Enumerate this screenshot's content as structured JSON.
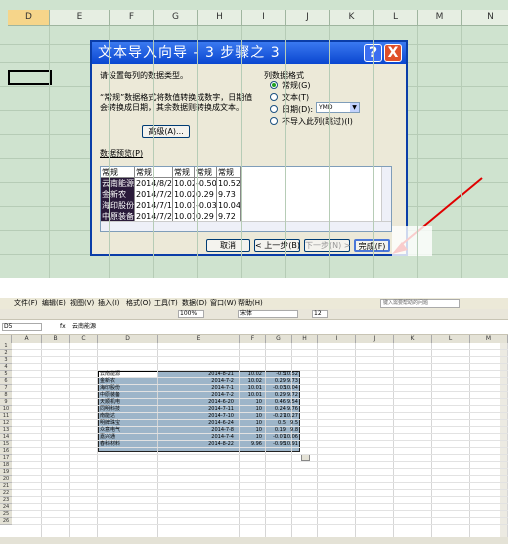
{
  "top_sheet": {
    "columns": [
      "D",
      "E",
      "F",
      "G",
      "H",
      "I",
      "J",
      "K",
      "L",
      "M",
      "N"
    ]
  },
  "dialog": {
    "title": "文本导入向导 - 3 步骤之 3",
    "help_glyph": "?",
    "close_glyph": "X",
    "instruction": "请设置每列的数据类型。",
    "note_line1": "“常规”数据格式将数值转换成数字，日期值",
    "note_line2": "会转换成日期，其余数据则转换成文本。",
    "advanced_button": "高级(A)...",
    "column_format_label": "列数据格式",
    "formats": [
      {
        "label": "常规(G)",
        "selected": true
      },
      {
        "label": "文本(T)",
        "selected": false
      },
      {
        "label": "日期(D):",
        "selected": false
      },
      {
        "label": "不导入此列(跳过)(I)",
        "selected": false
      }
    ],
    "date_format_value": "YMD",
    "preview_label": "数据预览(P)",
    "preview_headers": [
      "常规",
      "常规",
      "常规",
      "常规",
      "常规"
    ],
    "preview_rows": [
      [
        "云南能源",
        "2014/8/21",
        "10.02",
        "-0.50",
        "10.52"
      ],
      [
        "金新农",
        "2014/7/2",
        "10.02",
        "0.29",
        "9.73"
      ],
      [
        "海印股份",
        "2014/7/1",
        "10.01",
        "-0.03",
        "10.04"
      ],
      [
        "中原装备",
        "2014/7/2",
        "10.01",
        "0.29",
        "9.72"
      ]
    ],
    "cancel_button": "取消",
    "back_button": "< 上一步(B)",
    "next_button": "下一步(N) >",
    "finish_button": "完成(F)"
  },
  "bottom_sheet": {
    "menu": [
      "文件(F)",
      "编辑(E)",
      "视图(V)",
      "插入(I)",
      "格式(O)",
      "工具(T)",
      "数据(D)",
      "窗口(W)",
      "帮助(H)"
    ],
    "help_search_placeholder": "键入需要帮助的问题",
    "zoom": "100%",
    "font_name": "宋体",
    "font_size": "12",
    "name_box": "D5",
    "formula_value": "云南能源",
    "columns": [
      "A",
      "B",
      "C",
      "D",
      "E",
      "F",
      "G",
      "H",
      "I",
      "J",
      "K",
      "L",
      "M"
    ],
    "rows": [
      "1",
      "2",
      "3",
      "4",
      "5",
      "6",
      "7",
      "8",
      "9",
      "10",
      "11",
      "12",
      "13",
      "14",
      "15",
      "16",
      "17",
      "18",
      "19",
      "20",
      "21",
      "22",
      "23",
      "24",
      "25",
      "26"
    ],
    "data": [
      [
        "云南能源",
        "2014-8-21",
        "10.02",
        "-0.5",
        "10.52"
      ],
      [
        "金新农",
        "2014-7-2",
        "10.02",
        "0.29",
        "9.73"
      ],
      [
        "海印股份",
        "2014-7-1",
        "10.01",
        "-0.03",
        "10.04"
      ],
      [
        "中原装备",
        "2014-7-2",
        "10.01",
        "0.29",
        "9.72"
      ],
      [
        "天顺机电",
        "2014-6-20",
        "10",
        "0.46",
        "9.54"
      ],
      [
        "同明科技",
        "2014-7-11",
        "10",
        "0.24",
        "9.76"
      ],
      [
        "南能达",
        "2014-7-10",
        "10",
        "-0.27",
        "10.27"
      ],
      [
        "明牌珠宝",
        "2014-6-24",
        "10",
        "0.5",
        "9.5"
      ],
      [
        "众意电气",
        "2014-7-8",
        "10",
        "0.19",
        "9.8"
      ],
      [
        "嘉兴通",
        "2014-7-4",
        "10",
        "-0.07",
        "10.06"
      ],
      [
        "春科材料",
        "2014-8-22",
        "9.96",
        "-0.95",
        "10.91"
      ]
    ]
  }
}
